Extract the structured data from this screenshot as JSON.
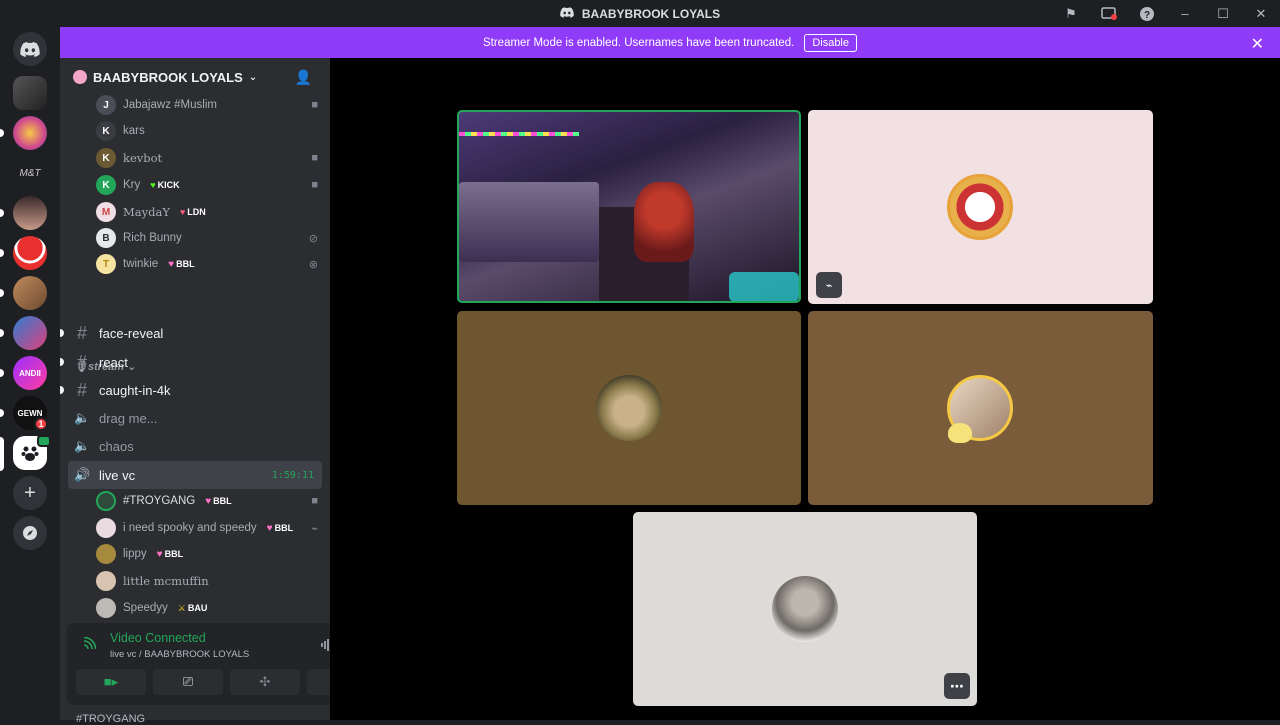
{
  "window": {
    "title": "BAABYBROOK LOYALS"
  },
  "banner": {
    "message": "Streamer Mode is enabled. Usernames have been truncated.",
    "disable_label": "Disable"
  },
  "server": {
    "name": "BAABYBROOK LOYALS",
    "badge_count": "1"
  },
  "members_top": [
    {
      "name": "Jabajawz #Muslim",
      "tag": "",
      "initial": "J"
    },
    {
      "name": "kars",
      "tag": "",
      "initial": "K"
    },
    {
      "name": "kevbot",
      "tag": "",
      "initial": "K"
    },
    {
      "name": "Kry",
      "tag": "KICK",
      "initial": "K"
    },
    {
      "name": "MaydaY",
      "tag": "LDN",
      "initial": "M"
    },
    {
      "name": "Rich Bunny",
      "tag": "",
      "initial": "B"
    },
    {
      "name": "twinkie",
      "tag": "BBL",
      "initial": "T"
    }
  ],
  "category": {
    "name": "stream"
  },
  "channels": [
    {
      "name": "face-reveal",
      "type": "text"
    },
    {
      "name": "react",
      "type": "text"
    },
    {
      "name": "caught-in-4k",
      "type": "text"
    },
    {
      "name": "drag me...",
      "type": "voice"
    },
    {
      "name": "chaos",
      "type": "voice"
    },
    {
      "name": "live vc",
      "type": "voice",
      "timer": "1:59:11"
    }
  ],
  "members_vc": [
    {
      "name": "#TROYGANG",
      "tag": "BBL"
    },
    {
      "name": "i need spooky and speedy",
      "tag": "BBL"
    },
    {
      "name": "lippy",
      "tag": "BBL"
    },
    {
      "name": "little mcmuffin",
      "tag": ""
    },
    {
      "name": "Speedyy",
      "tag": "BAU"
    }
  ],
  "voice_panel": {
    "status": "Video Connected",
    "location": "live vc / BAABYBROOK LOYALS"
  },
  "bottom_peek": {
    "name": "#TROYGANG"
  },
  "colors": {
    "accent_purple": "#8f3bf7",
    "online_green": "#23a55a",
    "tile_pink": "#f2e1e3",
    "tile_olive": "#6e5630",
    "tile_brown": "#7a5c3b",
    "tile_grey": "#dddbd8"
  }
}
